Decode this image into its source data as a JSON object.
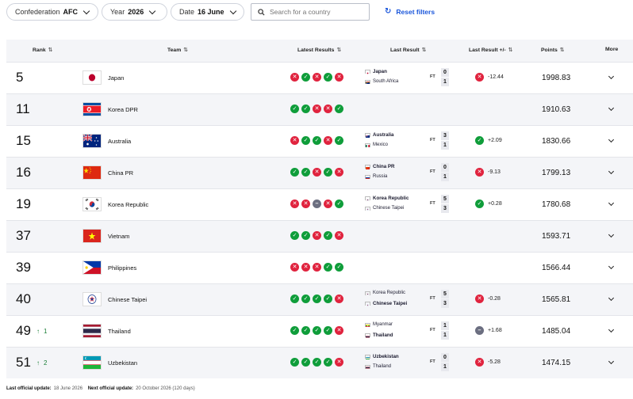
{
  "filters": {
    "confederation_label": "Confederation",
    "confederation_value": "AFC",
    "year_label": "Year",
    "year_value": "2026",
    "date_label": "Date",
    "date_value": "16 June",
    "search_placeholder": "Search for a country",
    "reset_label": "Reset filters"
  },
  "columns": {
    "rank": "Rank",
    "team": "Team",
    "latest_results": "Latest Results",
    "last_result": "Last Result",
    "last_result_change": "Last Result +/-",
    "points": "Points",
    "more": "More"
  },
  "rows": [
    {
      "rank": "5",
      "move": "",
      "team": "Japan",
      "flag": "japan",
      "results": [
        "L",
        "W",
        "L",
        "W",
        "L"
      ],
      "last": {
        "home": "Japan",
        "home_flag": "japan",
        "home_bold": true,
        "away": "South Africa",
        "away_flag": "southafrica",
        "away_bold": false,
        "home_score": "0",
        "away_score": "1",
        "ft": "FT"
      },
      "change": "-12.44",
      "change_type": "L",
      "points": "1998.83"
    },
    {
      "rank": "11",
      "move": "",
      "team": "Korea DPR",
      "flag": "koreadpr",
      "results": [
        "W",
        "W",
        "L",
        "L",
        "W"
      ],
      "last": null,
      "change": "",
      "change_type": "",
      "points": "1910.63"
    },
    {
      "rank": "15",
      "move": "",
      "team": "Australia",
      "flag": "australia",
      "results": [
        "L",
        "W",
        "W",
        "L",
        "W"
      ],
      "last": {
        "home": "Australia",
        "home_flag": "australia",
        "home_bold": true,
        "away": "Mexico",
        "away_flag": "mexico",
        "away_bold": false,
        "home_score": "3",
        "away_score": "1",
        "ft": "FT"
      },
      "change": "+2.09",
      "change_type": "W",
      "points": "1830.66"
    },
    {
      "rank": "16",
      "move": "",
      "team": "China PR",
      "flag": "china",
      "results": [
        "W",
        "W",
        "L",
        "W",
        "L"
      ],
      "last": {
        "home": "China PR",
        "home_flag": "china",
        "home_bold": true,
        "away": "Russia",
        "away_flag": "russia",
        "away_bold": false,
        "home_score": "0",
        "away_score": "1",
        "ft": "FT"
      },
      "change": "-9.13",
      "change_type": "L",
      "points": "1799.13"
    },
    {
      "rank": "19",
      "move": "",
      "team": "Korea Republic",
      "flag": "korea",
      "results": [
        "L",
        "L",
        "D",
        "L",
        "W"
      ],
      "last": {
        "home": "Korea Republic",
        "home_flag": "korea",
        "home_bold": true,
        "away": "Chinese Taipei",
        "away_flag": "taipei",
        "away_bold": false,
        "home_score": "5",
        "away_score": "3",
        "ft": "FT"
      },
      "change": "+0.28",
      "change_type": "W",
      "points": "1780.68"
    },
    {
      "rank": "37",
      "move": "",
      "team": "Vietnam",
      "flag": "vietnam",
      "results": [
        "W",
        "W",
        "L",
        "W",
        "L"
      ],
      "last": null,
      "change": "",
      "change_type": "",
      "points": "1593.71"
    },
    {
      "rank": "39",
      "move": "",
      "team": "Philippines",
      "flag": "philippines",
      "results": [
        "L",
        "L",
        "L",
        "W",
        "W"
      ],
      "last": null,
      "change": "",
      "change_type": "",
      "points": "1566.44"
    },
    {
      "rank": "40",
      "move": "",
      "team": "Chinese Taipei",
      "flag": "taipei",
      "results": [
        "W",
        "W",
        "W",
        "W",
        "L"
      ],
      "last": {
        "home": "Korea Republic",
        "home_flag": "korea",
        "home_bold": false,
        "away": "Chinese Taipei",
        "away_flag": "taipei",
        "away_bold": true,
        "home_score": "5",
        "away_score": "3",
        "ft": "FT"
      },
      "change": "-0.28",
      "change_type": "L",
      "points": "1565.81"
    },
    {
      "rank": "49",
      "move": "1",
      "team": "Thailand",
      "flag": "thailand",
      "results": [
        "W",
        "W",
        "W",
        "W",
        "L"
      ],
      "last": {
        "home": "Myanmar",
        "home_flag": "myanmar",
        "home_bold": false,
        "away": "Thailand",
        "away_flag": "thailand",
        "away_bold": true,
        "home_score": "1",
        "away_score": "1",
        "ft": "FT"
      },
      "change": "+1.68",
      "change_type": "D",
      "points": "1485.04"
    },
    {
      "rank": "51",
      "move": "2",
      "team": "Uzbekistan",
      "flag": "uzbekistan",
      "results": [
        "W",
        "W",
        "W",
        "W",
        "L"
      ],
      "last": {
        "home": "Uzbekistan",
        "home_flag": "uzbekistan",
        "home_bold": true,
        "away": "Thailand",
        "away_flag": "thailand",
        "away_bold": false,
        "home_score": "0",
        "away_score": "1",
        "ft": "FT"
      },
      "change": "-5.28",
      "change_type": "L",
      "points": "1474.15"
    }
  ],
  "footer": {
    "last_update_label": "Last official update:",
    "last_update_value": "18 June 2026",
    "next_update_label": "Next official update:",
    "next_update_value": "20 October 2026 (120 days)"
  },
  "colors": {
    "win": "#0f9d3a",
    "loss": "#e0233e",
    "draw": "#6b6e80",
    "accent": "#1a56db"
  }
}
